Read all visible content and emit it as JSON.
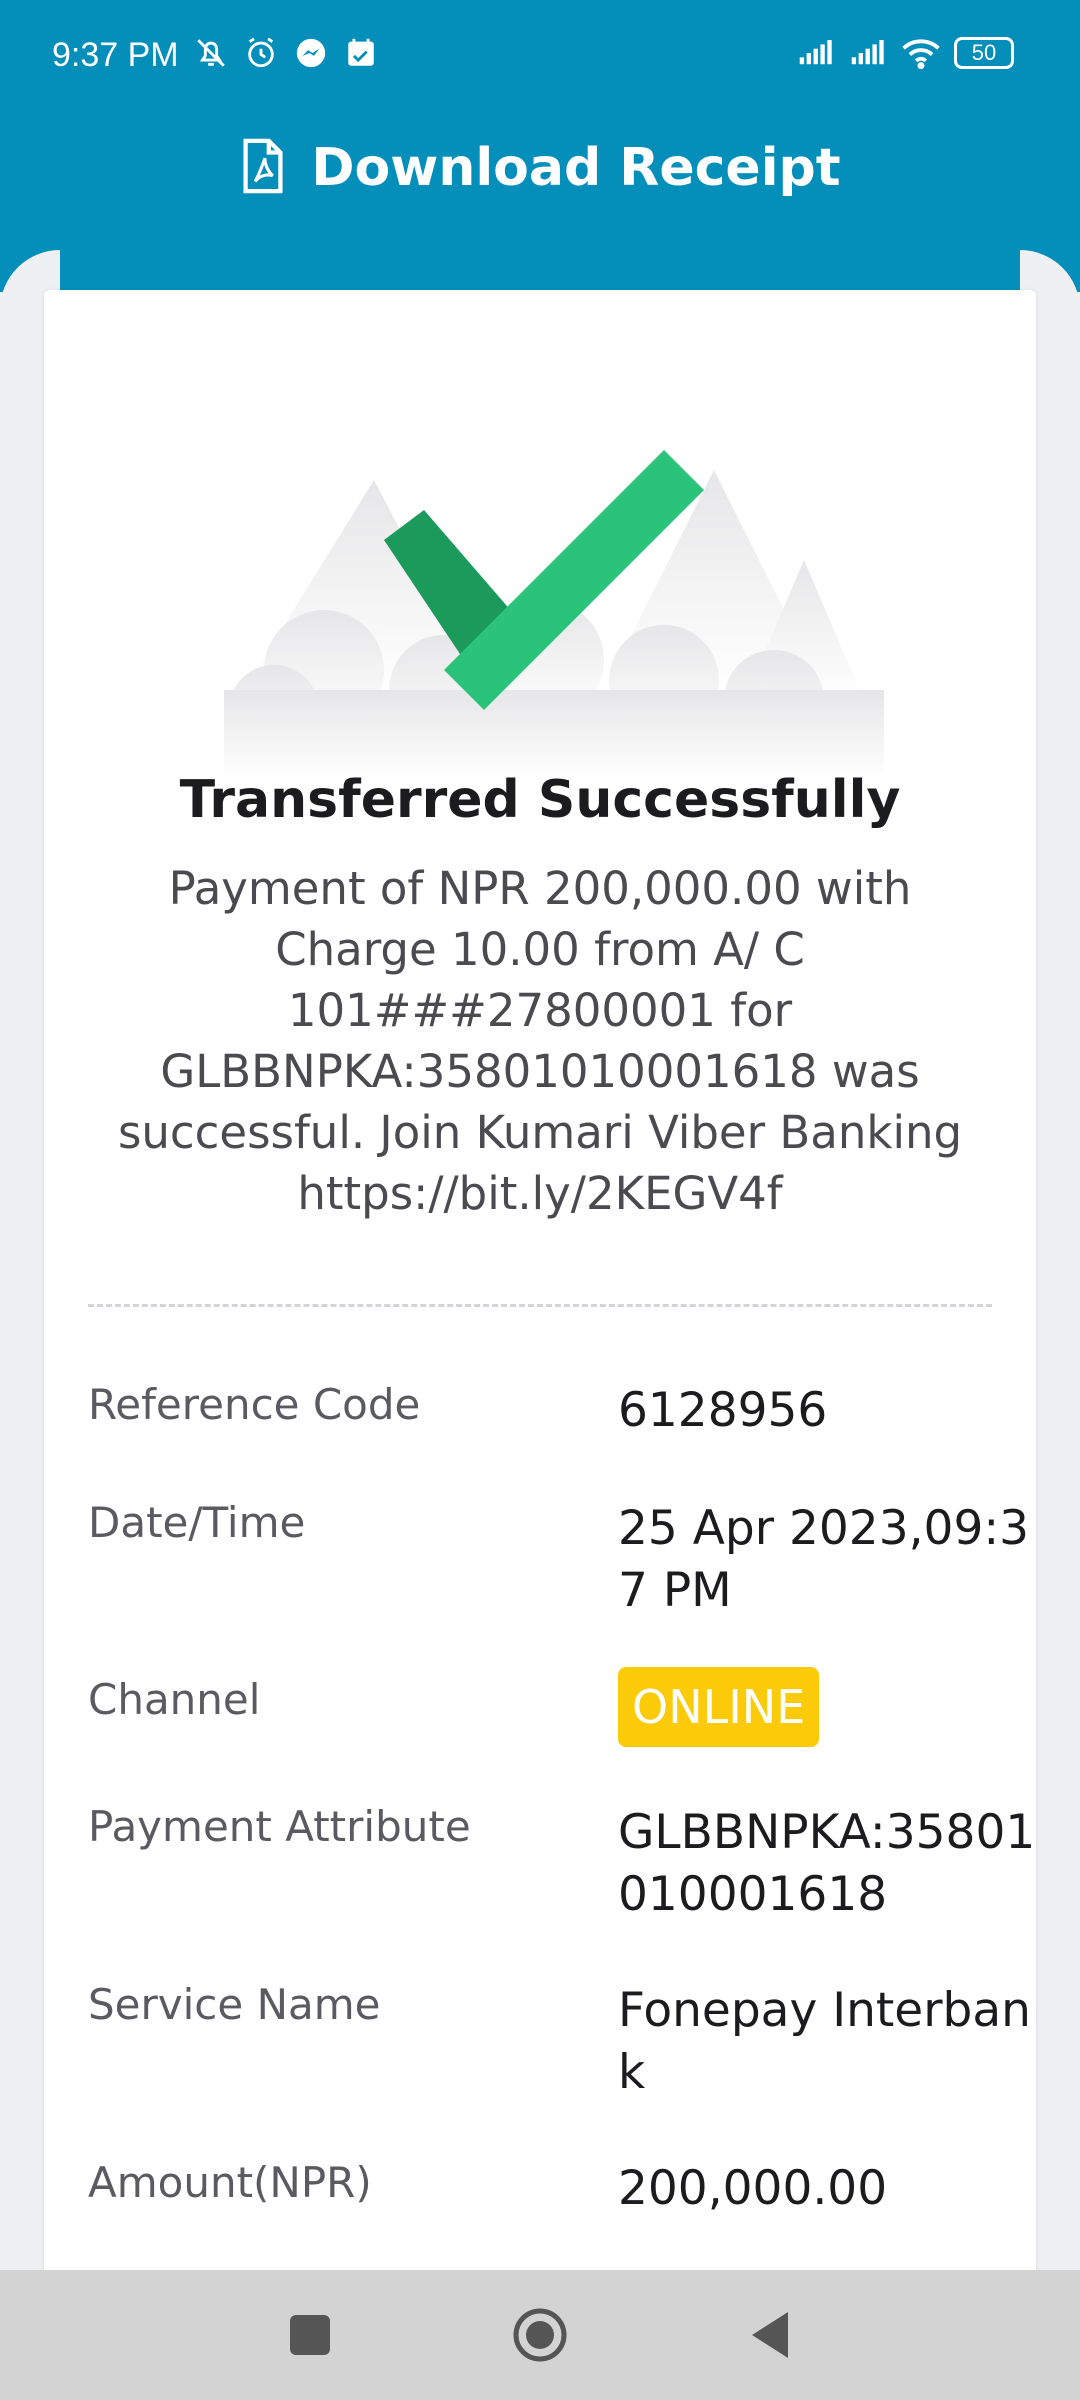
{
  "status_bar": {
    "time": "9:37 PM",
    "battery": "50",
    "left_icons": [
      "bell-off-icon",
      "alarm-icon",
      "messenger-icon",
      "calendar-icon"
    ],
    "right_icons": [
      "signal-icon",
      "signal-icon",
      "wifi-icon",
      "battery-icon"
    ]
  },
  "header": {
    "title": "Download Receipt",
    "icon": "pdf-file-icon",
    "color": "#048fba"
  },
  "receipt": {
    "hero_icon": "success-check-icon",
    "title": "Transferred Successfully",
    "message": "Payment of NPR 200,000.00 with Charge 10.00 from A/ C 101###27800001 for GLBBNPKA:35801010001618 was successful. Join Kumari Viber Banking https://bit.ly/2KEGV4f",
    "rows": [
      {
        "label": "Reference Code",
        "value": "6128956"
      },
      {
        "label": "Date/Time",
        "value": "25 Apr 2023,09:37 PM"
      },
      {
        "label": "Channel",
        "value": "ONLINE"
      },
      {
        "label": "Payment Attribute",
        "value": "GLBBNPKA:35801010001618"
      },
      {
        "label": "Service Name",
        "value": "Fonepay Interbank"
      },
      {
        "label": "Amount(NPR)",
        "value": "200,000.00"
      }
    ],
    "badge_color": "#fbcb0a",
    "check_color": "#2bc37a"
  },
  "nav": {
    "icons": [
      "recent-apps-icon",
      "home-icon",
      "back-icon"
    ]
  }
}
